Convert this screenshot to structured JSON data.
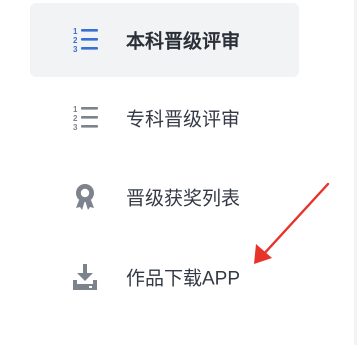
{
  "menu": {
    "items": [
      {
        "label": "本科晋级评审",
        "icon": "numbered-list-icon",
        "active": true
      },
      {
        "label": "专科晋级评审",
        "icon": "numbered-list-icon",
        "active": false
      },
      {
        "label": "晋级获奖列表",
        "icon": "award-ribbon-icon",
        "active": false
      },
      {
        "label": "作品下载APP",
        "icon": "download-tray-icon",
        "active": false
      }
    ]
  },
  "colors": {
    "active_background": "#f2f3f5",
    "active_icon": "#3b6fd4",
    "inactive_icon": "#7d838c",
    "annotation_arrow": "#e8332b"
  }
}
